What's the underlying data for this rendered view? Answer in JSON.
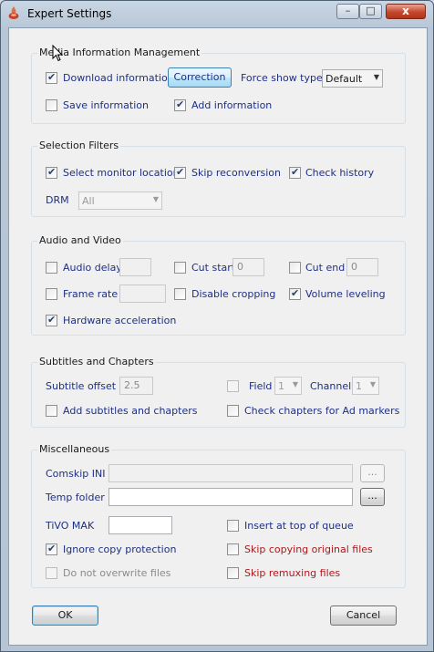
{
  "window": {
    "title": "Expert Settings",
    "min_glyph": "–",
    "max_glyph": "□",
    "close_glyph": "x"
  },
  "media_info": {
    "title": "Media Information Management",
    "download_info": "Download information",
    "correction": "Correction",
    "force_show_type": "Force show type",
    "force_show_value": "Default",
    "save_info": "Save information",
    "add_info": "Add information"
  },
  "selection": {
    "title": "Selection Filters",
    "select_monitor": "Select monitor locations",
    "skip_reconversion": "Skip reconversion",
    "check_history": "Check history",
    "drm": "DRM",
    "drm_value": "All"
  },
  "av": {
    "title": "Audio and Video",
    "audio_delay": "Audio delay",
    "audio_delay_value": "",
    "cut_start": "Cut start",
    "cut_start_value": "0",
    "cut_end": "Cut end",
    "cut_end_value": "0",
    "frame_rate": "Frame rate",
    "frame_rate_value": "",
    "disable_cropping": "Disable cropping",
    "volume_leveling": "Volume leveling",
    "hw_accel": "Hardware acceleration"
  },
  "subs": {
    "title": "Subtitles and Chapters",
    "subtitle_offset": "Subtitle offset",
    "subtitle_offset_value": "2.5",
    "field": "Field",
    "field_value": "1",
    "channel": "Channel",
    "channel_value": "1",
    "add_subs": "Add subtitles and chapters",
    "check_chapters": "Check chapters for Ad markers"
  },
  "misc": {
    "title": "Miscellaneous",
    "comskip_ini": "Comskip INI",
    "comskip_value": "",
    "browse": "...",
    "temp_folder": "Temp folder",
    "temp_value": "",
    "tivo_mak": "TiVO MAK",
    "tivo_value": "",
    "insert_top": "Insert at top of queue",
    "ignore_copy": "Ignore copy protection",
    "skip_copying": "Skip copying original files",
    "no_overwrite": "Do not overwrite files",
    "skip_remux": "Skip remuxing files"
  },
  "footer": {
    "ok": "OK",
    "cancel": "Cancel"
  }
}
